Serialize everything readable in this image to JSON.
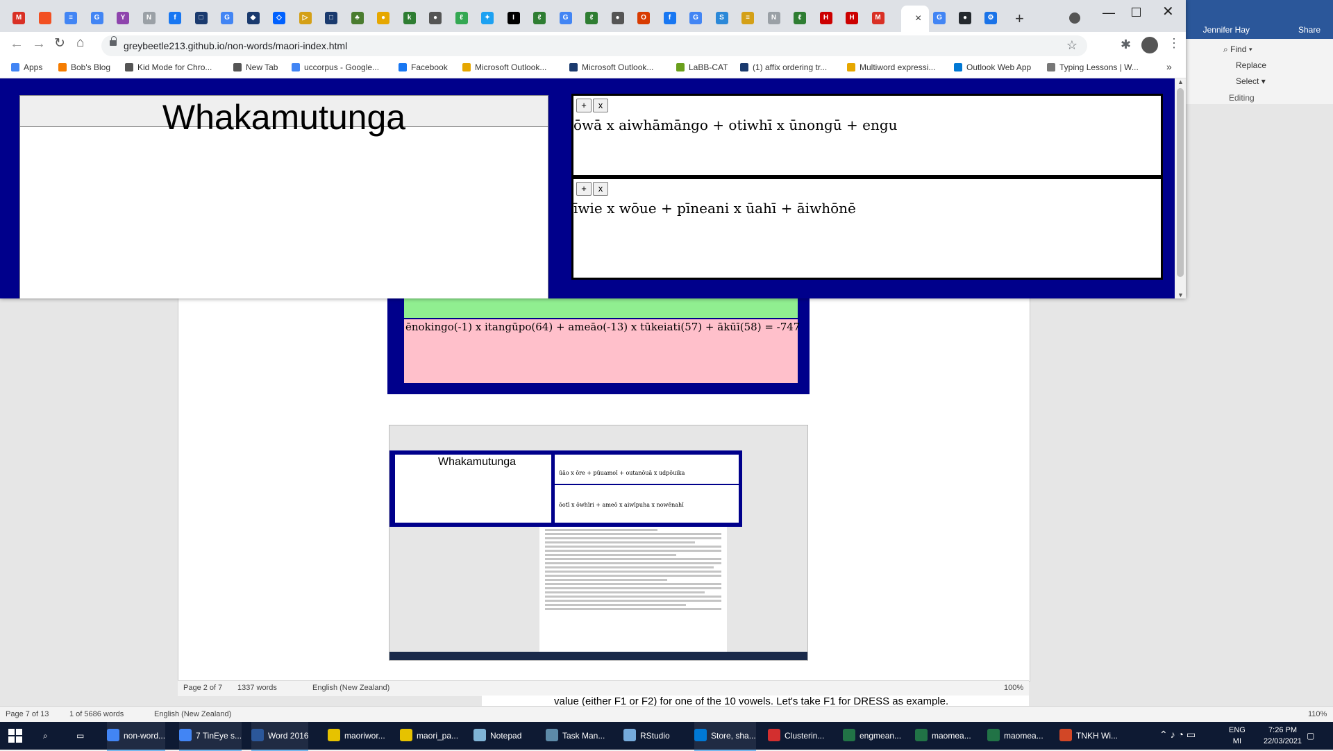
{
  "browser": {
    "active_tab_close": "×",
    "new_tab_symbol": "+",
    "window_controls": {
      "minimize": "—",
      "maximize": "",
      "close": "✕"
    },
    "url": "greybeetle213.github.io/non-words/maori-index.html",
    "tab_icons": [
      {
        "name": "tab-outlook",
        "color": "#d93025",
        "glyph": "M"
      },
      {
        "name": "tab-microsoft",
        "color": "#f25022",
        "glyph": ""
      },
      {
        "name": "tab-docs",
        "color": "#4285f4",
        "glyph": "≡"
      },
      {
        "name": "tab-google",
        "color": "#4285f4",
        "glyph": "G"
      },
      {
        "name": "tab-fork",
        "color": "#8e44ad",
        "glyph": "Y"
      },
      {
        "name": "tab-new",
        "color": "#9aa0a6",
        "glyph": "N"
      },
      {
        "name": "tab-facebook",
        "color": "#1877f2",
        "glyph": "f"
      },
      {
        "name": "tab-app",
        "color": "#1a3a6e",
        "glyph": "□"
      },
      {
        "name": "tab-google-2",
        "color": "#4285f4",
        "glyph": "G"
      },
      {
        "name": "tab-shield",
        "color": "#1a3a6e",
        "glyph": "◆"
      },
      {
        "name": "tab-dropbox",
        "color": "#0061ff",
        "glyph": "◇"
      },
      {
        "name": "tab-arrow",
        "color": "#d4a017",
        "glyph": "▷"
      },
      {
        "name": "tab-app-2",
        "color": "#1a3a6e",
        "glyph": "□"
      },
      {
        "name": "tab-crest",
        "color": "#4a7c2f",
        "glyph": "♣"
      },
      {
        "name": "tab-coin",
        "color": "#e6a700",
        "glyph": "●"
      },
      {
        "name": "tab-kupu",
        "color": "#2e7d32",
        "glyph": "k"
      },
      {
        "name": "tab-globe",
        "color": "#555555",
        "glyph": "●"
      },
      {
        "name": "tab-leaf",
        "color": "#34a853",
        "glyph": "ℓ"
      },
      {
        "name": "tab-twitter",
        "color": "#1da1f2",
        "glyph": "✦"
      },
      {
        "name": "tab-ibt",
        "color": "#000000",
        "glyph": "I"
      },
      {
        "name": "tab-fern",
        "color": "#2e7d32",
        "glyph": "ℓ"
      },
      {
        "name": "tab-google-3",
        "color": "#4285f4",
        "glyph": "G"
      },
      {
        "name": "tab-fern-2",
        "color": "#2e7d32",
        "glyph": "ℓ"
      },
      {
        "name": "tab-globe-2",
        "color": "#555555",
        "glyph": "●"
      },
      {
        "name": "tab-office",
        "color": "#d83b01",
        "glyph": "O"
      },
      {
        "name": "tab-facebook-2",
        "color": "#1877f2",
        "glyph": "f"
      },
      {
        "name": "tab-google-4",
        "color": "#4285f4",
        "glyph": "G"
      },
      {
        "name": "tab-s",
        "color": "#2b88d8",
        "glyph": "S"
      },
      {
        "name": "tab-doc",
        "color": "#d4a017",
        "glyph": "≡"
      },
      {
        "name": "tab-new-2",
        "color": "#9aa0a6",
        "glyph": "N"
      },
      {
        "name": "tab-fern-3",
        "color": "#2e7d32",
        "glyph": "ℓ"
      },
      {
        "name": "tab-hm",
        "color": "#cc0000",
        "glyph": "H"
      },
      {
        "name": "tab-hm-2",
        "color": "#cc0000",
        "glyph": "H"
      },
      {
        "name": "tab-outlook-2",
        "color": "#d93025",
        "glyph": "M"
      }
    ],
    "tabs_after_active": [
      {
        "name": "tab-google-5",
        "color": "#4285f4",
        "glyph": "G"
      },
      {
        "name": "tab-github",
        "color": "#24292e",
        "glyph": "●"
      },
      {
        "name": "tab-settings",
        "color": "#1a73e8",
        "glyph": "⚙"
      }
    ],
    "bookmarks": [
      {
        "label": "Apps",
        "color": "#4285f4"
      },
      {
        "label": "Bob's Blog",
        "color": "#f57c00"
      },
      {
        "label": "Kid Mode for Chro...",
        "color": "#555555"
      },
      {
        "label": "New Tab",
        "color": "#555555"
      },
      {
        "label": "uccorpus - Google...",
        "color": "#4285f4"
      },
      {
        "label": "Facebook",
        "color": "#1877f2"
      },
      {
        "label": "Microsoft Outlook...",
        "color": "#e6a700"
      },
      {
        "label": "Microsoft Outlook...",
        "color": "#1a3a6e"
      },
      {
        "label": "LaBB-CAT",
        "color": "#6a9f1c"
      },
      {
        "label": "(1) affix ordering tr...",
        "color": "#1a3a6e"
      },
      {
        "label": "Multiword expressi...",
        "color": "#e6a700"
      },
      {
        "label": "Outlook Web App",
        "color": "#0078d4"
      },
      {
        "label": "Typing Lessons | W...",
        "color": "#777777"
      }
    ],
    "bookmarks_more": "»"
  },
  "page": {
    "left_panel_title": "Whakamutunga",
    "panels": [
      {
        "add_label": "+",
        "remove_label": "x",
        "text": "ōwā x aiwhāmāngo + otiwhī x ūnongū + engu"
      },
      {
        "add_label": "+",
        "remove_label": "x",
        "text": "īwie x wōue + pīneani x ūahī + āiwhōnē"
      }
    ]
  },
  "word_background": {
    "user_name": "Jennifer Hay",
    "share_label": "Share",
    "find_label": "Find",
    "replace_label": "Replace",
    "select_label": "Select",
    "editing_group_label": "Editing",
    "inner_doc_equation": "ēnokingo(-1) x itangūpo(64) + ameāo(-13) x tūkeiati(57) + ākūī(58) = -747",
    "thumbnail_title": "Whakamutunga",
    "thumbnail_panel_1": "ūāo x ōre + pūuamoī + outanōuā x udpōuika",
    "thumbnail_panel_2": "ōotī x ōwhīri + ameō x aiwīpuha x nowēnahī",
    "inner_status": {
      "page": "Page 2 of 7",
      "words": "1337 words",
      "language": "English (New Zealand)",
      "zoom": "100%"
    },
    "outer_doc_line": "value (either F1 or F2) for one of the 10 vowels. Let's take F1 for DRESS as example.",
    "outer_status": {
      "page": "Page 7 of 13",
      "words": "1 of 5686 words",
      "language": "English (New Zealand)",
      "zoom": "110%"
    }
  },
  "taskbar": {
    "items": [
      {
        "label": "non-word...",
        "color": "#4285f4",
        "active": true
      },
      {
        "label": "7 TinEye s...",
        "color": "#4285f4",
        "active": true
      },
      {
        "label": "Word 2016",
        "color": "#2b579a",
        "active": true
      },
      {
        "label": "maoriwor...",
        "color": "#e6c200",
        "active": false
      },
      {
        "label": "maori_pa...",
        "color": "#e6c200",
        "active": false
      },
      {
        "label": "Notepad",
        "color": "#7fb3d5",
        "active": false
      },
      {
        "label": "Task Man...",
        "color": "#5d8aa8",
        "active": false
      },
      {
        "label": "RStudio",
        "color": "#75aadb",
        "active": false
      },
      {
        "label": "Store, sha...",
        "color": "#0078d4",
        "active": true
      },
      {
        "label": "Clusterin...",
        "color": "#d32f2f",
        "active": false
      },
      {
        "label": "engmean...",
        "color": "#217346",
        "active": false
      },
      {
        "label": "maomea...",
        "color": "#217346",
        "active": false
      },
      {
        "label": "maomea...",
        "color": "#217346",
        "active": false
      },
      {
        "label": "TNKH Wi...",
        "color": "#d24726",
        "active": false
      }
    ],
    "tray_lang_1": "ENG",
    "tray_lang_2": "MI",
    "tray_time": "7:26 PM",
    "tray_date": "22/03/2021"
  }
}
